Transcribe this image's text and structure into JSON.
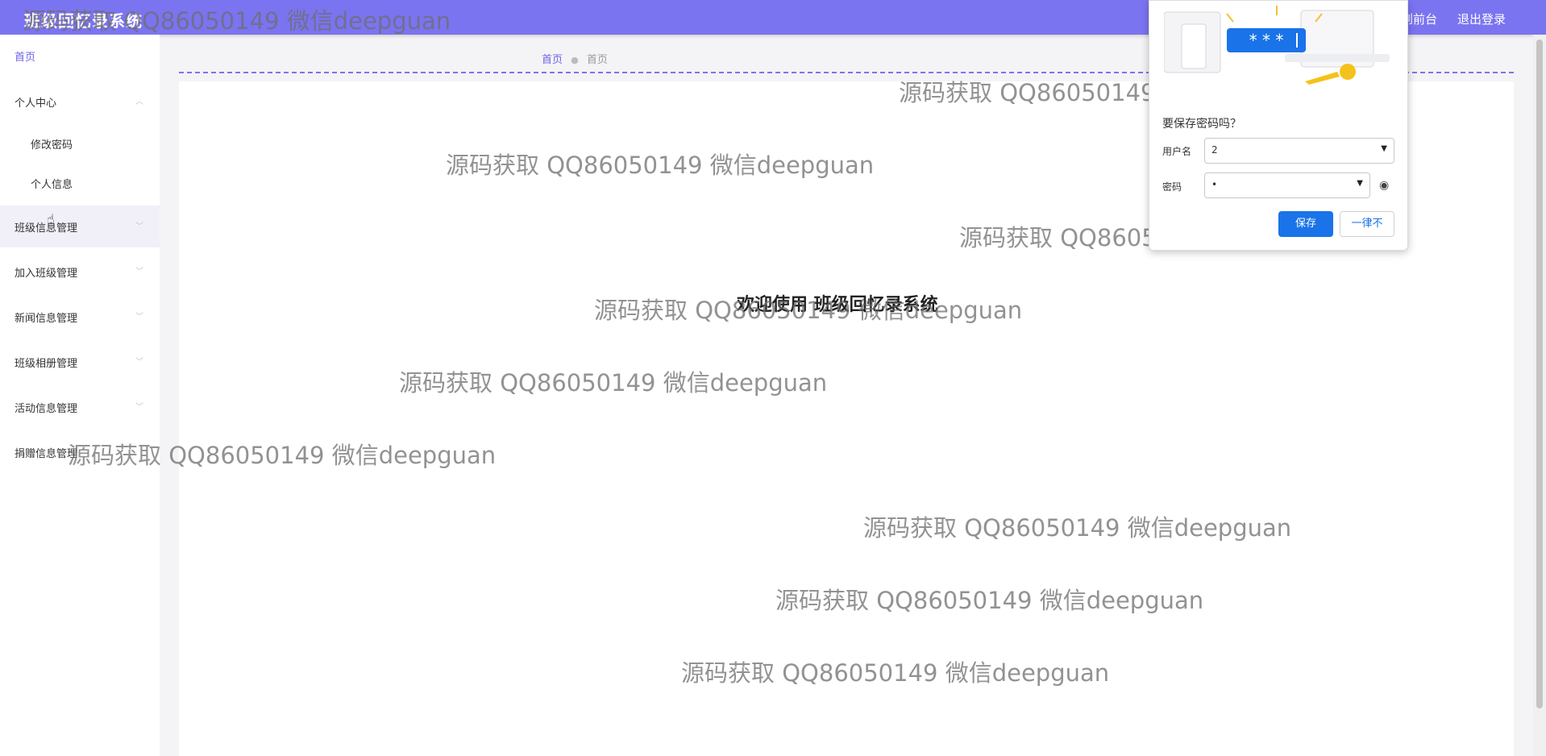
{
  "app": {
    "title": "班级回忆录系统"
  },
  "topbar": {
    "links": [
      "跳转到前台",
      "退出登录"
    ]
  },
  "sidebar": {
    "items": [
      {
        "label": "首页",
        "type": "link",
        "active": true
      },
      {
        "label": "个人中心",
        "type": "group",
        "expanded": true
      },
      {
        "label": "修改密码",
        "type": "sub"
      },
      {
        "label": "个人信息",
        "type": "sub"
      },
      {
        "label": "班级信息管理",
        "type": "group"
      },
      {
        "label": "加入班级管理",
        "type": "group"
      },
      {
        "label": "新闻信息管理",
        "type": "group"
      },
      {
        "label": "班级相册管理",
        "type": "group"
      },
      {
        "label": "活动信息管理",
        "type": "group"
      },
      {
        "label": "捐赠信息管理",
        "type": "group"
      }
    ]
  },
  "breadcrumb": {
    "items": [
      "首页",
      "首页"
    ]
  },
  "main": {
    "welcome": "欢迎使用 班级回忆录系统"
  },
  "watermark": {
    "text": "源码获取 QQ86050149 微信deepguan"
  },
  "password_prompt": {
    "question": "要保存密码吗？",
    "username_label": "用户名",
    "username_value": "2",
    "password_label": "密码",
    "password_value": "•",
    "save_label": "保存",
    "never_label": "一律不",
    "illustration_text": "* * *"
  },
  "colors": {
    "accent": "#7b74f1",
    "primary_button": "#1a73e8"
  },
  "icons": {
    "cursor": "hand-cursor-icon",
    "eye": "eye-icon",
    "separator": "breadcrumb-separator-icon"
  }
}
